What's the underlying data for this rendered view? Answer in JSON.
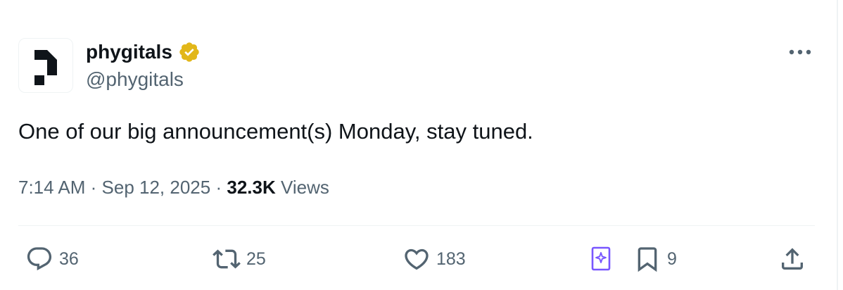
{
  "author": {
    "display_name": "phygitals",
    "handle": "@phygitals",
    "verified": true,
    "verified_badge_color": "#e2b719",
    "avatar_icon": "phygitals-logo"
  },
  "tweet": {
    "text": "One of our big announcement(s) Monday, stay tuned."
  },
  "meta": {
    "time": "7:14 AM",
    "separator": "·",
    "date": "Sep 12, 2025",
    "views_count": "32.3K",
    "views_label": "Views"
  },
  "actions": {
    "reply": {
      "icon": "reply-icon",
      "count": "36"
    },
    "retweet": {
      "icon": "retweet-icon",
      "count": "25"
    },
    "like": {
      "icon": "heart-icon",
      "count": "183"
    },
    "grok": {
      "icon": "grok-bookmark-icon",
      "color": "#7856ff"
    },
    "bookmark": {
      "icon": "bookmark-icon",
      "count": "9"
    },
    "share": {
      "icon": "share-icon"
    }
  },
  "colors": {
    "text_primary": "#0f1419",
    "text_secondary": "#536471",
    "divider": "#eff3f4"
  }
}
